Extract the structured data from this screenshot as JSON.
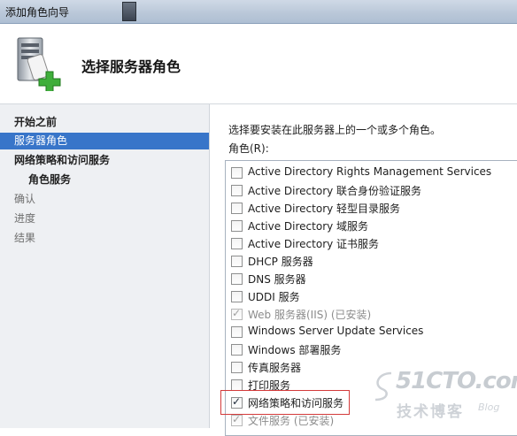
{
  "window": {
    "title": "添加角色向导"
  },
  "header": {
    "heading": "选择服务器角色"
  },
  "nav": {
    "items": [
      {
        "label": "开始之前",
        "style": "bold",
        "top": 0
      },
      {
        "label": "服务器角色",
        "style": "selected"
      },
      {
        "label": "网络策略和访问服务",
        "style": "bold"
      },
      {
        "label": "角色服务",
        "style": "sub"
      },
      {
        "label": "确认",
        "style": "dim"
      },
      {
        "label": "进度",
        "style": "dim"
      },
      {
        "label": "结果",
        "style": "dim"
      }
    ]
  },
  "main": {
    "instruction": "选择要安装在此服务器上的一个或多个角色。",
    "roles_label": "角色(R):",
    "roles": [
      {
        "label": "Active Directory Rights Management Services",
        "checked": false,
        "disabled": false
      },
      {
        "label": "Active Directory 联合身份验证服务",
        "checked": false,
        "disabled": false
      },
      {
        "label": "Active Directory 轻型目录服务",
        "checked": false,
        "disabled": false
      },
      {
        "label": "Active Directory 域服务",
        "checked": false,
        "disabled": false
      },
      {
        "label": "Active Directory 证书服务",
        "checked": false,
        "disabled": false
      },
      {
        "label": "DHCP 服务器",
        "checked": false,
        "disabled": false
      },
      {
        "label": "DNS 服务器",
        "checked": false,
        "disabled": false
      },
      {
        "label": "UDDI 服务",
        "checked": false,
        "disabled": false
      },
      {
        "label": "Web 服务器(IIS)  (已安装)",
        "checked": true,
        "disabled": true
      },
      {
        "label": "Windows Server Update Services",
        "checked": false,
        "disabled": false
      },
      {
        "label": "Windows 部署服务",
        "checked": false,
        "disabled": false
      },
      {
        "label": "传真服务器",
        "checked": false,
        "disabled": false
      },
      {
        "label": "打印服务",
        "checked": false,
        "disabled": false
      },
      {
        "label": "网络策略和访问服务",
        "checked": true,
        "disabled": false
      },
      {
        "label": "文件服务  (已安装)",
        "checked": true,
        "disabled": true
      }
    ]
  },
  "watermark": {
    "main": "51CTO.com",
    "sub": "技术博客",
    "blog": "Blog"
  },
  "colors": {
    "selection": "#3875c9",
    "highlight_box": "#d33a3a",
    "nav_bg": "#eef0f3"
  }
}
